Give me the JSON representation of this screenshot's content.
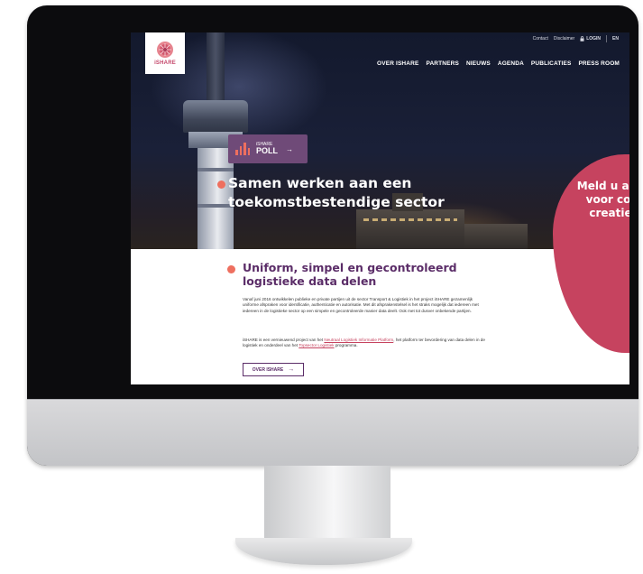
{
  "site": {
    "logo_text": "iSHARE",
    "util_nav": {
      "contact": "Contact",
      "disclaimer": "Disclaimer",
      "login": "LOGIN",
      "language": "EN"
    },
    "main_nav": [
      "OVER ISHARE",
      "PARTNERS",
      "NIEUWS",
      "AGENDA",
      "PUBLICATIES",
      "PRESS ROOM"
    ]
  },
  "hero": {
    "poll_small": "iSHARE",
    "poll_big": "POLL",
    "poll_arrow": "→",
    "title": "Samen werken aan een toekomstbestendige sector",
    "cta_blob": "Meld u aan voor co-creatie"
  },
  "section": {
    "title": "Uniform, simpel en gecontroleerd logistieke data delen",
    "paragraph1": "Vanaf juni 2016 ontwikkelen publieke en private partijen uit de sector Transport & Logistiek in het project iSHARE gezamenlijk uniforme afspraken voor identificatie, authenticatie en autorisatie. Met dit afsprakenstelsel is het straks mogelijk dat iedereen met iedereen in de logistieke sector op een simpele en gecontroleerde manier data deelt. Ook met tot dusver onbekende partijen.",
    "p2_before": "iSHARE is een vernieuwend project van het ",
    "p2_link1": "Neutraal Logistiek Informatie Platform",
    "p2_middle": ", het platform ter bevordering van data delen in de logistiek en onderdeel van het ",
    "p2_link2": "Topsector Logistiek",
    "p2_after": " programma.",
    "button_label": "OVER ISHARE",
    "button_arrow": "→"
  },
  "colors": {
    "brand_purple": "#5b2d68",
    "brand_coral": "#ee6f5f",
    "cta_pink": "#c6435f",
    "poll_purple": "#6f4a78"
  },
  "icons": [
    "ishare-logo-icon",
    "lock-icon",
    "poll-bars-icon",
    "arrow-right-icon"
  ]
}
